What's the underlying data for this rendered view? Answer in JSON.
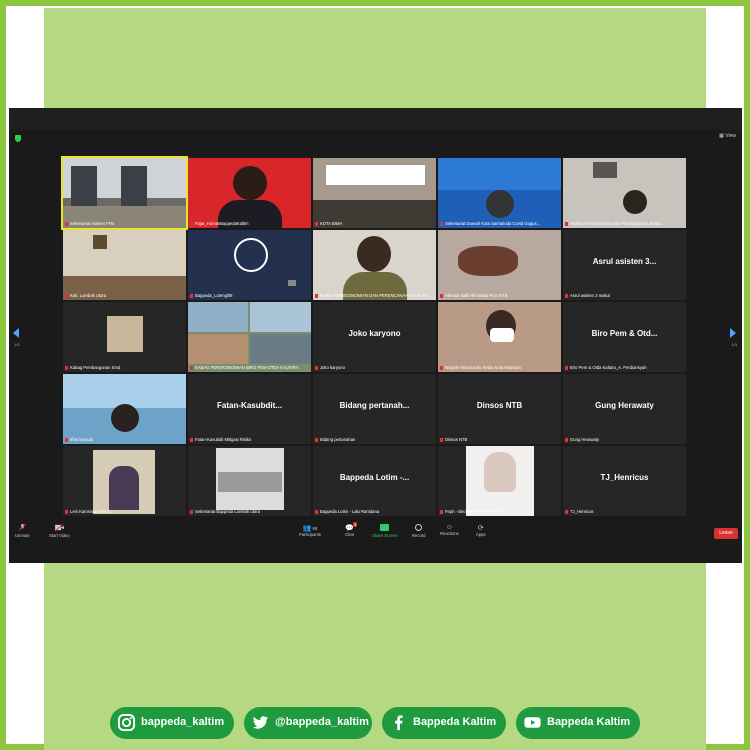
{
  "colors": {
    "frame": "#8cc63f",
    "panel": "#b5d982",
    "zoom_bg": "#1a1a1a",
    "social": "#1f9a3e",
    "leave": "#d93030"
  },
  "topbar": {
    "view_label": "View"
  },
  "pages": {
    "left": "1/3",
    "right": "1/3"
  },
  "tiles": [
    {
      "label": "Sekretariat Asisten FFB",
      "big": ""
    },
    {
      "label": "Fajar_HumasBappedaKaltim",
      "big": ""
    },
    {
      "label": "KOTA BIMA",
      "big": ""
    },
    {
      "label": "Sekretariat Daerah Kota Samarinda Covid Gugus...",
      "big": ""
    },
    {
      "label": "Asisten Perekonomian dan Pembangunan Setda ...",
      "big": ""
    },
    {
      "label": "Kab. Lombok Utara",
      "big": ""
    },
    {
      "label": "Bappeda_Lotengl08",
      "big": ""
    },
    {
      "label": "KABID PEREKONOMIAN DAN PERENCANAAN KAB SUMBAWA",
      "big": ""
    },
    {
      "label": "Ahmadi staff Ahli Setda Prov NTB",
      "big": ""
    },
    {
      "label": "Asrul asisten 3 makut",
      "big": "Asrul asisten 3..."
    },
    {
      "label": "Kabag Pembangunan Smd",
      "big": ""
    },
    {
      "label": "KABAG PEREKONOMIAN BIRO PEM OTDA KALTARA",
      "big": ""
    },
    {
      "label": "Joko karyono",
      "big": "Joko karyono"
    },
    {
      "label": "Ningsih Wiarmantio Setda Kota Mataram",
      "big": ""
    },
    {
      "label": "Biro Pem & Otda Kaltara_A. Perdiansyah",
      "big": "Biro Pem & Otd..."
    },
    {
      "label": "irfan karyudi",
      "big": ""
    },
    {
      "label": "Fatan-Kasubdit Mitigasi Risiko",
      "big": "Fatan-Kasubdit..."
    },
    {
      "label": "Bidang pertanahan",
      "big": "Bidang pertanah..."
    },
    {
      "label": "Dinsos NTB",
      "big": "Dinsos NTB"
    },
    {
      "label": "Gung Herawaty",
      "big": "Gung Herawaty"
    },
    {
      "label": "Leni Kamsinah Eko O",
      "big": ""
    },
    {
      "label": "Sekretariat Bappeda Lombok utara",
      "big": ""
    },
    {
      "label": "Bappeda Lotim - Lalu Ramdana",
      "big": "Bappeda Lotim -..."
    },
    {
      "label": "Feph - Biro HO Kampeng Ekon",
      "big": ""
    },
    {
      "label": "TJ_Henricus",
      "big": "TJ_Henricus"
    }
  ],
  "toolbar": {
    "unmute": "Unmute",
    "start_video": "Start Video",
    "participants": "Participants",
    "participants_count": "68",
    "chat": "Chat",
    "chat_badge": "3",
    "share_screen": "Share Screen",
    "record": "Record",
    "reactions": "Reactions",
    "apps": "Apps",
    "leave": "Leave"
  },
  "social": [
    {
      "icon": "instagram-icon",
      "label": "bappeda_kaltim"
    },
    {
      "icon": "twitter-icon",
      "label": "@bappeda_kaltim"
    },
    {
      "icon": "facebook-icon",
      "label": "Bappeda Kaltim"
    },
    {
      "icon": "youtube-icon",
      "label": "Bappeda Kaltim"
    }
  ]
}
